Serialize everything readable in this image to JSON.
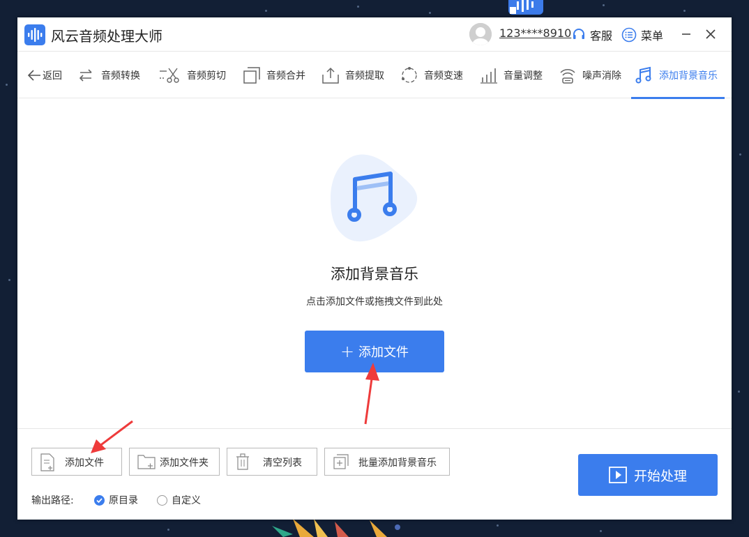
{
  "app": {
    "title": "风云音频处理大师",
    "user_id": "123****8910",
    "service_label": "客服",
    "menu_label": "菜单"
  },
  "toolbar": {
    "back_label": "返回",
    "items": [
      {
        "label": "音频转换",
        "icon": "convert-icon"
      },
      {
        "label": "音频剪切",
        "icon": "scissors-icon"
      },
      {
        "label": "音频合并",
        "icon": "merge-icon"
      },
      {
        "label": "音频提取",
        "icon": "extract-icon"
      },
      {
        "label": "音频变速",
        "icon": "speed-icon"
      },
      {
        "label": "音量调整",
        "icon": "volume-bars-icon"
      },
      {
        "label": "噪声消除",
        "icon": "noise-icon"
      },
      {
        "label": "添加背景音乐",
        "icon": "music-note-icon",
        "active": true
      }
    ]
  },
  "dropzone": {
    "title": "添加背景音乐",
    "hint": "点击添加文件或拖拽文件到此处",
    "add_button": "添加文件",
    "add_button_prefix": "+"
  },
  "bottom": {
    "buttons": [
      "添加文件",
      "添加文件夹",
      "清空列表",
      "批量添加背景音乐"
    ],
    "output_label": "输出路径:",
    "radio_original": "原目录",
    "radio_custom": "自定义",
    "selected_output": "原目录",
    "start_button": "开始处理"
  },
  "colors": {
    "accent": "#3b7ded",
    "annotation_arrow": "#ee3b3b"
  }
}
